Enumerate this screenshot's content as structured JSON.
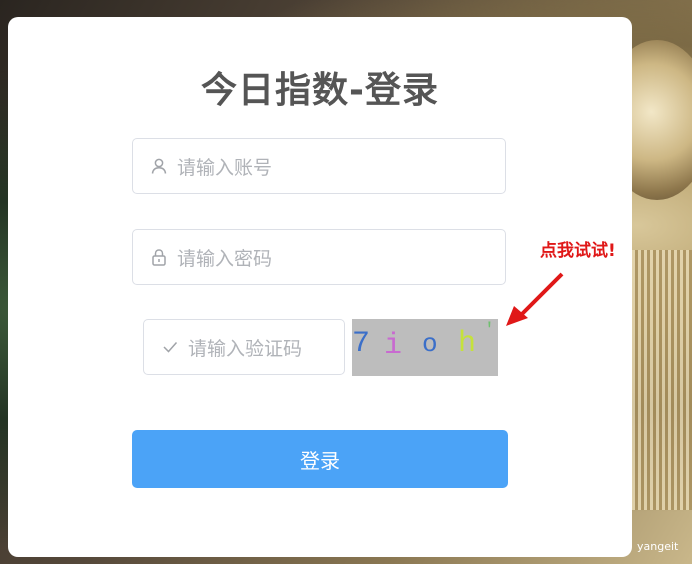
{
  "login": {
    "title": "今日指数-登录",
    "username_placeholder": "请输入账号",
    "password_placeholder": "请输入密码",
    "captcha_placeholder": "请输入验证码",
    "captcha_chars": [
      "7",
      "i",
      "o",
      "h",
      "'"
    ],
    "submit_label": "登录"
  },
  "annotation": {
    "hint": "点我试试!"
  },
  "watermark": "yangeit",
  "icons": {
    "username": "user-icon",
    "password": "lock-icon",
    "captcha": "check-icon"
  },
  "colors": {
    "primary": "#4ba3f7",
    "hint": "#e01818",
    "title": "#555555",
    "placeholder": "#b0b3b8",
    "captcha_bg": "#bdbdbd"
  }
}
